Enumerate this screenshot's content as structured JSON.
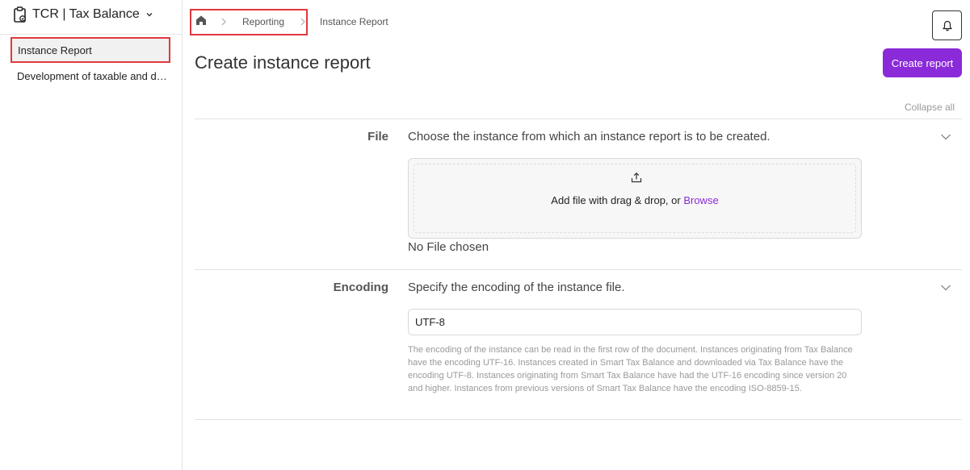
{
  "app": {
    "title": "TCR | Tax Balance"
  },
  "sidebar": {
    "items": [
      {
        "label": "Instance Report",
        "active": true
      },
      {
        "label": "Development of taxable and deductible temporary differences"
      }
    ]
  },
  "breadcrumb": {
    "items": [
      "Reporting",
      "Instance Report"
    ]
  },
  "page": {
    "title": "Create instance report",
    "create_button": "Create report",
    "collapse_all": "Collapse all"
  },
  "sections": {
    "file": {
      "label": "File",
      "description": "Choose the instance from which an instance report is to be created.",
      "dropzone_text": "Add file with drag & drop, or ",
      "browse_label": "Browse",
      "status": "No File chosen"
    },
    "encoding": {
      "label": "Encoding",
      "description": "Specify the encoding of the instance file.",
      "value": "UTF-8",
      "help": "The encoding of the instance can be read in the first row of the document. Instances originating from Tax Balance have the encoding UTF-16. Instances created in Smart Tax Balance and downloaded via Tax Balance have the encoding UTF-8. Instances originating from Smart Tax Balance have had the UTF-16 encoding since version 20 and higher. Instances from previous versions of Smart Tax Balance have the encoding ISO-8859-15."
    }
  },
  "colors": {
    "accent": "#8b2ad8",
    "highlight": "#e0393e"
  },
  "icons": [
    "clipboard-icon",
    "chevron-down-icon",
    "home-icon",
    "chevron-right-icon",
    "bell-icon",
    "upload-icon"
  ]
}
